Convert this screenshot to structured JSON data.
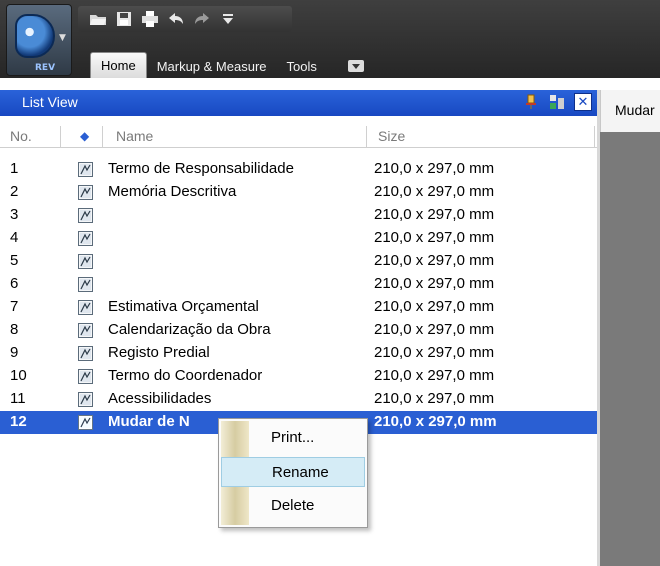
{
  "app": {
    "brand_label": "REV"
  },
  "ribbon": {
    "tabs": [
      {
        "label": "Home",
        "active": true
      },
      {
        "label": "Markup & Measure",
        "active": false
      },
      {
        "label": "Tools",
        "active": false
      }
    ],
    "quick_access_icons": [
      "open-folder-icon",
      "save-icon",
      "print-icon",
      "undo-icon",
      "redo-icon",
      "customize-dropdown-icon"
    ]
  },
  "panel": {
    "title": "List View",
    "columns": {
      "no": "No.",
      "name": "Name",
      "size": "Size"
    }
  },
  "rows": [
    {
      "no": "1",
      "name": "Termo de Responsabilidade",
      "size": "210,0 x 297,0 mm"
    },
    {
      "no": "2",
      "name": "Memória Descritiva",
      "size": "210,0 x 297,0 mm"
    },
    {
      "no": "3",
      "name": "",
      "size": "210,0 x 297,0 mm"
    },
    {
      "no": "4",
      "name": "",
      "size": "210,0 x 297,0 mm"
    },
    {
      "no": "5",
      "name": "",
      "size": "210,0 x 297,0 mm"
    },
    {
      "no": "6",
      "name": "",
      "size": "210,0 x 297,0 mm"
    },
    {
      "no": "7",
      "name": "Estimativa Orçamental",
      "size": "210,0 x 297,0 mm"
    },
    {
      "no": "8",
      "name": "Calendarização da Obra",
      "size": "210,0 x 297,0 mm"
    },
    {
      "no": "9",
      "name": "Registo Predial",
      "size": "210,0 x 297,0 mm"
    },
    {
      "no": "10",
      "name": "Termo do Coordenador",
      "size": "210,0 x 297,0 mm"
    },
    {
      "no": "11",
      "name": "Acessibilidades",
      "size": "210,0 x 297,0 mm"
    },
    {
      "no": "12",
      "name": "Mudar de N",
      "size": "210,0 x 297,0 mm",
      "selected": true
    }
  ],
  "context_menu": {
    "items": [
      {
        "label": "Print...",
        "highlighted": false
      },
      {
        "label": "Rename",
        "highlighted": true
      },
      {
        "label": "Delete",
        "highlighted": false
      }
    ]
  },
  "document_tab": {
    "label": "Mudar"
  },
  "colors": {
    "panel_header": "#1848c2",
    "selection": "#2a5fd3",
    "menu_highlight": "#d5ecf6",
    "ribbon_dark": "#262626"
  }
}
